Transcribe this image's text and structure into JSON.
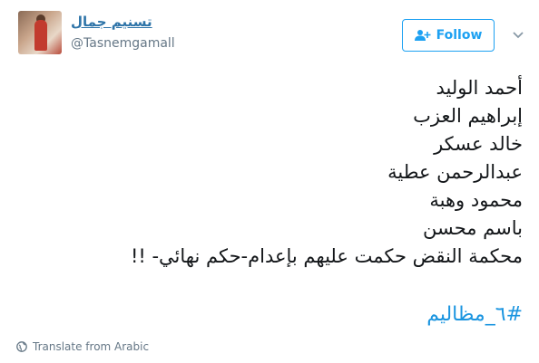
{
  "author": {
    "display_name": "تسنيم جمال",
    "handle": "@Tasnemgamall"
  },
  "follow_button": {
    "label": "Follow",
    "icon": "person-add-icon"
  },
  "menu": {
    "icon": "chevron-down-icon"
  },
  "tweet": {
    "lines": [
      "أحمد الوليد",
      "إبراهيم العزب",
      "خالد عسكر",
      "عبدالرحمن عطية",
      "محمود وهبة",
      "باسم محسن",
      "محكمة النقض حكمت عليهم بإعدام-حكم نهائي- !!"
    ],
    "hashtag": "#٦_مظاليم"
  },
  "translate": {
    "label": "Translate from Arabic",
    "icon": "globe-icon"
  },
  "colors": {
    "accent": "#1da1f2",
    "hashtag": "#1b95e0",
    "secondary_text": "#657786",
    "name": "#2e74a8"
  }
}
